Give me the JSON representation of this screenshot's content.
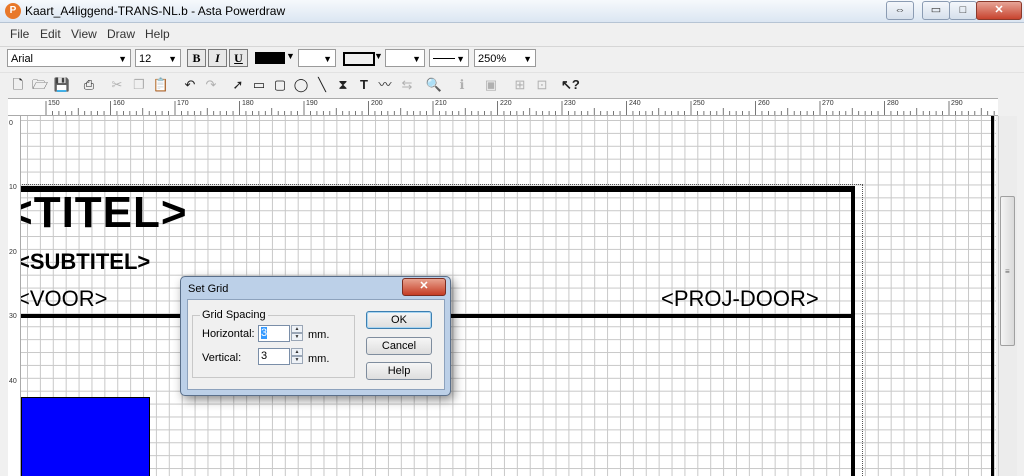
{
  "window": {
    "title": "Kaart_A4liggend-TRANS-NL.b - Asta Powerdraw",
    "icon_glyph": "P",
    "controls": {
      "restore": "⇔",
      "minimize": "▭",
      "maximize": "□",
      "close": "✕"
    }
  },
  "menu": {
    "items": [
      {
        "key": "file",
        "label": "File"
      },
      {
        "key": "edit",
        "label": "Edit"
      },
      {
        "key": "view",
        "label": "View"
      },
      {
        "key": "draw",
        "label": "Draw"
      },
      {
        "key": "help",
        "label": "Help"
      }
    ]
  },
  "format_toolbar": {
    "font": "Arial",
    "size": "12",
    "bold": "B",
    "italic": "I",
    "underline": "U",
    "zoom": "250%",
    "fill_color": "#000000"
  },
  "toolbar": {
    "tools": [
      "new-icon",
      "open-icon",
      "save-icon",
      "print-icon",
      "cut-icon",
      "copy-icon",
      "paste-icon",
      "undo-icon",
      "redo-icon",
      "pointer-icon",
      "rectangle-icon",
      "rounded-rectangle-icon",
      "ellipse-icon",
      "line-icon",
      "symbol-icon",
      "text-icon",
      "polyline-icon",
      "connector-icon",
      "dimension-icon",
      "zoom-icon",
      "info-icon",
      "group-icon",
      "align-icon",
      "arrange-icon",
      "context-help-icon"
    ]
  },
  "ruler": {
    "labels": [
      "150",
      "160",
      "170",
      "180",
      "190",
      "200",
      "210",
      "220",
      "230",
      "240",
      "250",
      "260",
      "270",
      "280",
      "290"
    ],
    "vlabels": [
      "0",
      "10",
      "20",
      "30",
      "40"
    ]
  },
  "drawing": {
    "titel": "<TITEL>",
    "subtitel": "<SUBTITEL>",
    "voor": "<VOOR>",
    "projdoor": "<PROJ-DOOR>",
    "blue_color": "#0000ff"
  },
  "dialog": {
    "title": "Set Grid",
    "close": "✕",
    "group_label": "Grid Spacing",
    "horizontal_label": "Horizontal:",
    "horizontal_value": "3",
    "vertical_label": "Vertical:",
    "vertical_value": "3",
    "unit": "mm.",
    "ok": "OK",
    "cancel": "Cancel",
    "help": "Help"
  }
}
